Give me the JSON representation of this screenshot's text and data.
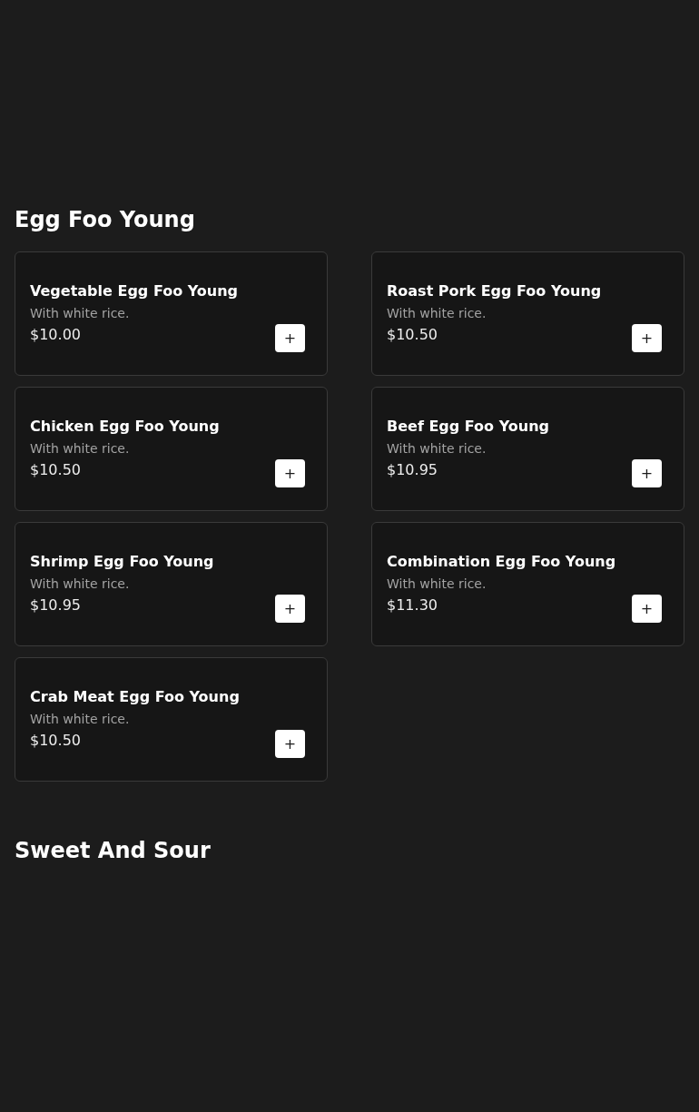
{
  "sections": [
    {
      "title": "Egg Foo Young",
      "items": [
        {
          "name": "Vegetable Egg Foo Young",
          "description": "With white rice.",
          "price": "$10.00",
          "button": "+"
        },
        {
          "name": "Roast Pork Egg Foo Young",
          "description": "With white rice.",
          "price": "$10.50",
          "button": "+"
        },
        {
          "name": "Chicken Egg Foo Young",
          "description": "With white rice.",
          "price": "$10.50",
          "button": "+"
        },
        {
          "name": "Beef Egg Foo Young",
          "description": "With white rice.",
          "price": "$10.95",
          "button": "+"
        },
        {
          "name": "Shrimp Egg Foo Young",
          "description": "With white rice.",
          "price": "$10.95",
          "button": "+"
        },
        {
          "name": "Combination Egg Foo Young",
          "description": "With white rice.",
          "price": "$11.30",
          "button": "+"
        },
        {
          "name": "Crab Meat Egg Foo Young",
          "description": "With white rice.",
          "price": "$10.50",
          "button": "+"
        }
      ]
    },
    {
      "title": "Sweet And Sour"
    }
  ]
}
